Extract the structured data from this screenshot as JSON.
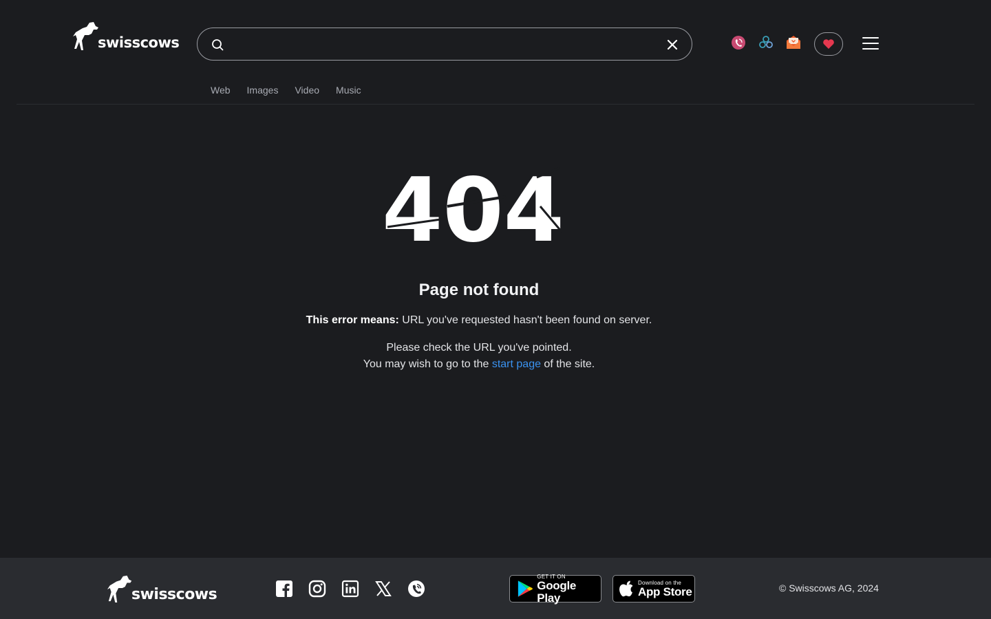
{
  "header": {
    "logo_text": "swisscows",
    "search": {
      "value": "",
      "placeholder": ""
    },
    "tabs": [
      {
        "label": "Web"
      },
      {
        "label": "Images"
      },
      {
        "label": "Video"
      },
      {
        "label": "Music"
      }
    ]
  },
  "main": {
    "code": "404",
    "title": "Page not found",
    "error_label": "This error means:",
    "error_text": " URL you've requested hasn't been found on server.",
    "check_text": "Please check the URL you've pointed.",
    "go_prefix": "You may wish to go to the ",
    "go_link": "start page",
    "go_suffix": " of the site."
  },
  "footer": {
    "logo_text": "swisscows",
    "google_play": {
      "small": "GET IT ON",
      "big": "Google Play"
    },
    "app_store": {
      "small": "Download on the",
      "big": "App Store"
    },
    "copyright": "© Swisscows AG, 2024"
  },
  "icons": {
    "search": "search-icon",
    "clear": "close-icon",
    "vpn": "vpn-icon",
    "teleguard": "teleguard-icon",
    "mail": "mail-icon",
    "donate": "heart-icon",
    "menu": "hamburger-menu-icon",
    "social": [
      "facebook-icon",
      "instagram-icon",
      "linkedin-icon",
      "x-icon",
      "teleguard-icon"
    ]
  },
  "colors": {
    "background": "#1b1c1f",
    "footer_bg": "#2a2c30",
    "link": "#3a92f0",
    "heart": "#e5384f",
    "vpn_accent": "#c94a72",
    "teleguard_accent": "#3aa0b8",
    "mail_accent": "#f05a28"
  }
}
